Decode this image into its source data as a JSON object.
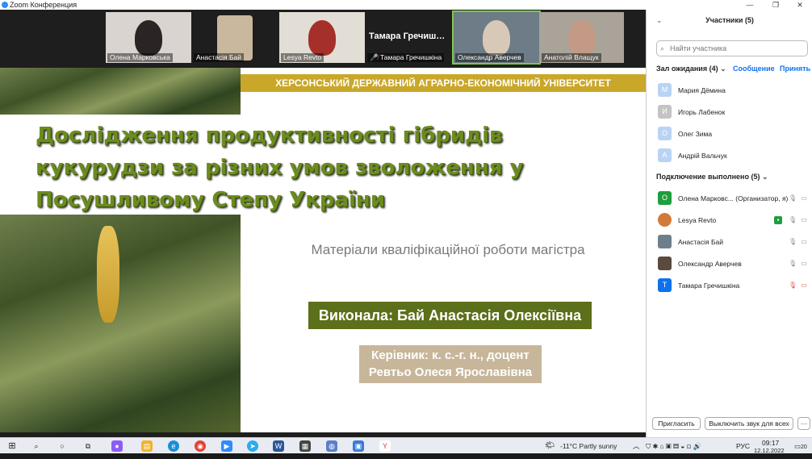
{
  "window": {
    "title": "Zoom Конференция"
  },
  "strip": {
    "tiles": [
      {
        "name": "Олена Марковська"
      },
      {
        "name": "Анастасія Бай"
      },
      {
        "name": "Lesya Revto"
      },
      {
        "name": "Тамара Гречишкіна",
        "display": "Тамара Гречиш…"
      },
      {
        "name": "Олександр Аверчев"
      },
      {
        "name": "Анатолій Влащук"
      }
    ]
  },
  "slide": {
    "banner": "ХЕРСОНСЬКИЙ ДЕРЖАВНИЙ АГРАРНО-ЕКОНОМІЧНИЙ УНІВЕРСИТЕТ",
    "title": "Дослідження продуктивності гібридів кукурудзи за різних умов зволоження у Посушливому Степу України",
    "subtitle": "Матеріали кваліфікаційної роботи магістра",
    "author": "Виконала: Бай Анастасія Олексіївна",
    "supervisor_line1": "Керівник: к. с.-г. н., доцент",
    "supervisor_line2": "Ревтьо Олеся Ярославівна"
  },
  "panel": {
    "header": "Участники (5)",
    "search_placeholder": "Найти участника",
    "waiting_label": "Зал ожидания (4)",
    "message_link": "Сообщение",
    "admit_link": "Принять",
    "waiting": [
      {
        "name": "Мария Дёмина",
        "initial": "М",
        "color": "#b9d3f5"
      },
      {
        "name": "Игорь Лабенок",
        "initial": "И",
        "color": "#c4c4c4"
      },
      {
        "name": "Олег Зима",
        "initial": "О",
        "color": "#b9d3f5"
      },
      {
        "name": "Андрій Вальчук",
        "initial": "А",
        "color": "#b9d3f5"
      }
    ],
    "connected_label": "Подключение выполнено (5)",
    "connected": [
      {
        "name": "Олена Марковс...  (Организатор, я)",
        "initial": "О",
        "color": "#1e9e3c"
      },
      {
        "name": "Lesya Revto",
        "initial": "",
        "color": "#d27a3a"
      },
      {
        "name": "Анастасія Бай",
        "initial": "",
        "color": "#6d7f8c"
      },
      {
        "name": "Олександр Аверчев",
        "initial": "",
        "color": "#5c4a3c"
      },
      {
        "name": "Тамара Гречишкіна",
        "initial": "Т",
        "color": "#0e72ed"
      }
    ],
    "invite_button": "Пригласить",
    "mute_all_button": "Выключить звук для всех",
    "more_button": "···"
  },
  "taskbar": {
    "weather": "-11°C  Partly sunny",
    "language": "РУС",
    "time": "09:17",
    "date": "12.12.2022",
    "notification_count": "20"
  },
  "colors": {
    "zoom_blue": "#0e72ed",
    "banner_gold": "#c9a728",
    "title_green": "#6b8c1e",
    "author_bg": "#5c6f1a",
    "supervisor_bg": "#c7b69a"
  }
}
